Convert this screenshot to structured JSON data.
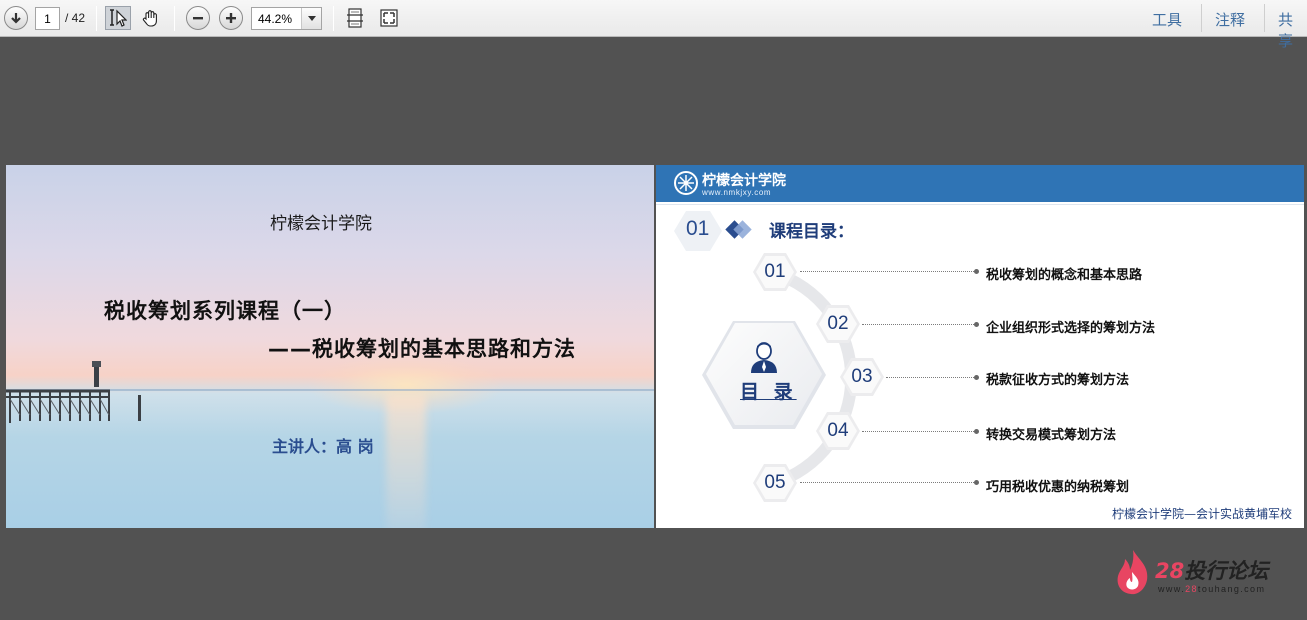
{
  "toolbar": {
    "page_current": "1",
    "page_total": "/ 42",
    "zoom": "44.2%",
    "icons": [
      "download-arrow-icon",
      "select-cursor-icon",
      "hand-tool-icon",
      "zoom-out-icon",
      "zoom-in-icon",
      "fit-page-icon",
      "fullscreen-icon"
    ],
    "right_links": [
      "工具",
      "注释",
      "共享"
    ]
  },
  "slide1": {
    "org": "柠檬会计学院",
    "title": "税收筹划系列课程（一）",
    "subtitle": "——税收筹划的基本思路和方法",
    "speaker": "主讲人：高    岗"
  },
  "slide2": {
    "brand": "柠檬会计学院",
    "url": "www.nmkjxy.com",
    "section_number": "01",
    "heading": "课程目录：",
    "menu_label": "目 录",
    "items": [
      {
        "num": "01",
        "text": "税收筹划的概念和基本思路"
      },
      {
        "num": "02",
        "text": "企业组织形式选择的筹划方法"
      },
      {
        "num": "03",
        "text": "税款征收方式的筹划方法"
      },
      {
        "num": "04",
        "text": "转换交易模式筹划方法"
      },
      {
        "num": "05",
        "text": "巧用税收优惠的纳税筹划"
      }
    ],
    "footer": "柠檬会计学院—会计实战黄埔军校"
  },
  "watermark": {
    "brand_num": "28",
    "brand_text": "投行论坛",
    "url_prefix": "www.",
    "url_highlight": "28",
    "url_suffix": "touhang.com"
  },
  "colors": {
    "viewer_bg": "#525252",
    "slide_blue": "#2f74b5",
    "navy_text": "#1f3d7a",
    "toolbar_link": "#3f6ea1",
    "watermark_red": "#e84562"
  }
}
